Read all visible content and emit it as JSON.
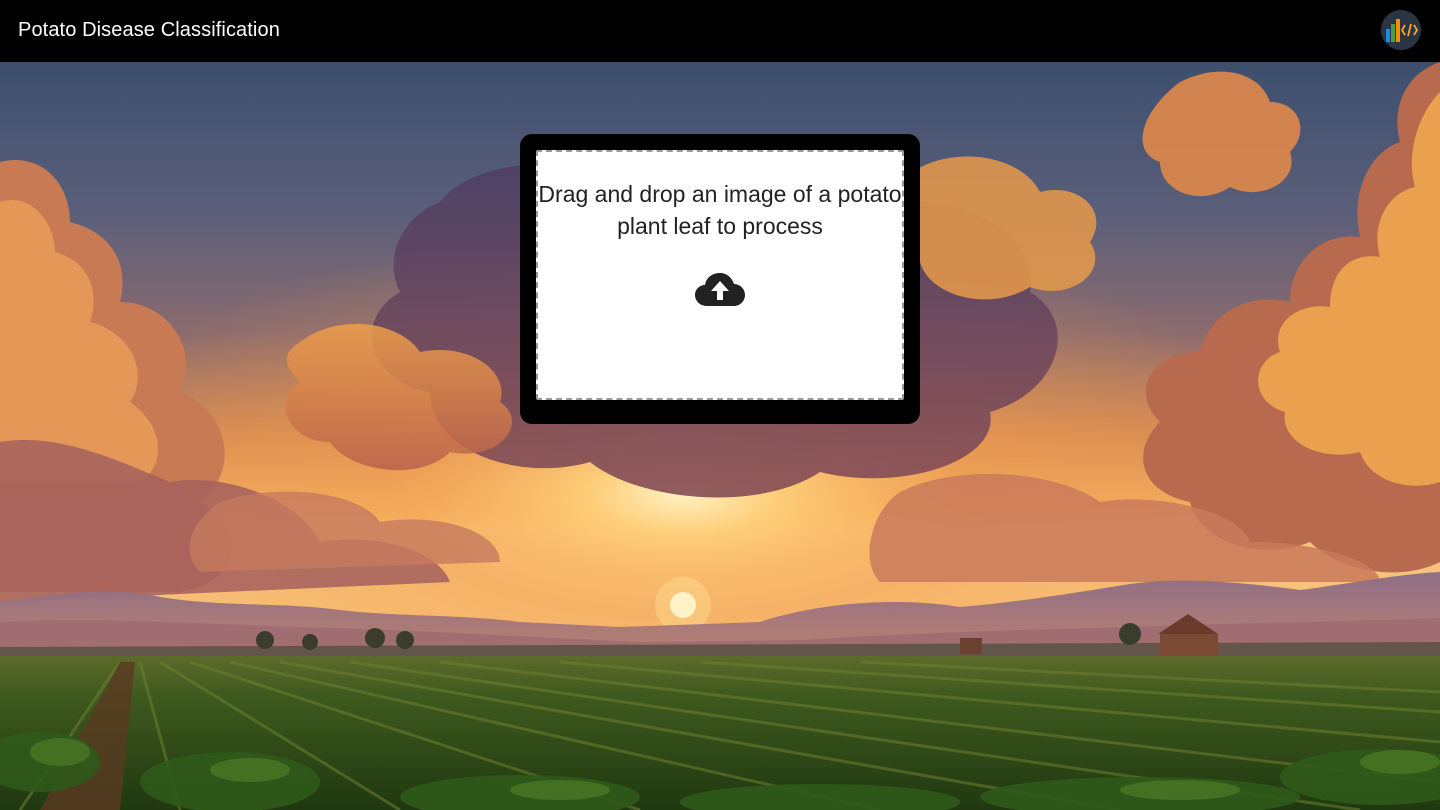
{
  "header": {
    "title": "Potato Disease Classification",
    "logo_icon": "bar-chart-code-logo-icon"
  },
  "dropzone": {
    "message": "Drag and drop an image of a potato plant leaf to process",
    "icon": "cloud-upload-icon"
  },
  "background": {
    "description_icon": "farm-sunset-background"
  },
  "colors": {
    "header_bg": "#000000",
    "header_text": "#ffffff",
    "card_bg": "#000000",
    "dropzone_bg": "#ffffff",
    "dropzone_text": "#222222"
  }
}
